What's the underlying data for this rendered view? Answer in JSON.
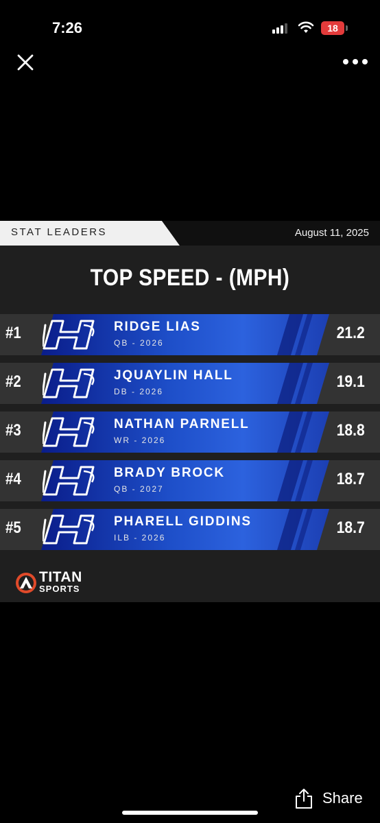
{
  "status_bar": {
    "time": "7:26",
    "battery": "18",
    "signal_bars": 3
  },
  "toolbar": {
    "close_icon": "close-icon",
    "more_icon": "more-horizontal-icon"
  },
  "graphic": {
    "header": {
      "section": "STAT LEADERS",
      "date": "August 11, 2025"
    },
    "title": "TOP SPEED - (MPH)",
    "leaders": [
      {
        "rank": "#1",
        "name": "RIDGE LIAS",
        "detail": "QB - 2026",
        "value": "21.2"
      },
      {
        "rank": "#2",
        "name": "JQUAYLIN HALL",
        "detail": "DB - 2026",
        "value": "19.1"
      },
      {
        "rank": "#3",
        "name": "NATHAN PARNELL",
        "detail": "WR - 2026",
        "value": "18.8"
      },
      {
        "rank": "#4",
        "name": "BRADY BROCK",
        "detail": "QB - 2027",
        "value": "18.7"
      },
      {
        "rank": "#5",
        "name": "PHARELL GIDDINS",
        "detail": "ILB - 2026",
        "value": "18.7"
      }
    ],
    "brand": {
      "name": "TITAN",
      "sub": "SPORTS"
    },
    "colors": {
      "band_blue": "#1e4fc9",
      "row_bg": "#333333",
      "panel_bg": "#1f1f1f",
      "brand_accent": "#e04a2a"
    }
  },
  "share": {
    "label": "Share"
  }
}
